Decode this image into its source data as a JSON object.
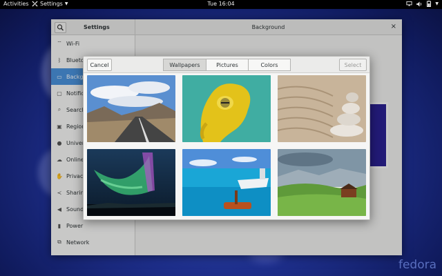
{
  "topbar": {
    "activities": "Activities",
    "app_menu": "Settings",
    "clock": "Tue 16:04",
    "tray_icons": [
      "network-icon",
      "volume-icon",
      "battery-icon",
      "system-menu-chevron"
    ]
  },
  "settings_window": {
    "sidebar_title": "Settings",
    "panel_title": "Background",
    "close_glyph": "×",
    "sidebar": {
      "items": [
        {
          "label": "Wi-Fi",
          "icon": "wifi-icon"
        },
        {
          "label": "Bluetoo",
          "icon": "bluetooth-icon"
        },
        {
          "label": "Backgro",
          "icon": "background-icon",
          "selected": true
        },
        {
          "label": "Notifica",
          "icon": "notifications-icon"
        },
        {
          "label": "Search",
          "icon": "search-icon"
        },
        {
          "label": "Region",
          "icon": "region-icon"
        },
        {
          "label": "Univers",
          "icon": "universal-access-icon"
        },
        {
          "label": "Online a",
          "icon": "online-accounts-icon"
        },
        {
          "label": "Privacy",
          "icon": "privacy-icon"
        },
        {
          "label": "Sharing",
          "icon": "sharing-icon"
        },
        {
          "label": "Sound",
          "icon": "sound-icon"
        },
        {
          "label": "Power",
          "icon": "power-icon"
        },
        {
          "label": "Network",
          "icon": "network-icon"
        }
      ]
    }
  },
  "dialog": {
    "cancel_label": "Cancel",
    "select_label": "Select",
    "tabs": [
      {
        "label": "Wallpapers",
        "active": true
      },
      {
        "label": "Pictures",
        "active": false
      },
      {
        "label": "Colors",
        "active": false
      }
    ],
    "thumbnails": [
      {
        "name": "road-landscape"
      },
      {
        "name": "yellow-frog"
      },
      {
        "name": "zen-stones"
      },
      {
        "name": "aurora"
      },
      {
        "name": "tropical-water"
      },
      {
        "name": "green-valley"
      }
    ]
  },
  "branding": {
    "logo_text": "fedora"
  },
  "colors": {
    "accent": "#4a90d9",
    "desktop": "#1e2f8c"
  }
}
